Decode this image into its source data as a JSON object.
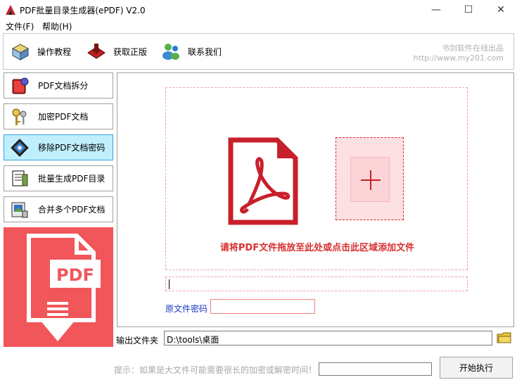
{
  "window": {
    "title": "PDF批量目录生成器(ePDF) V2.0",
    "minimize": "—",
    "maximize": "☐",
    "close": "✕"
  },
  "menu": {
    "file": "文件(F)",
    "help": "帮助(H)"
  },
  "toolbar": {
    "guide": "操作教程",
    "buy": "获取正版",
    "contact": "联系我们",
    "brand_line1": "书剑软件在线出品",
    "brand_line2": "http://www.my201.com"
  },
  "nav": {
    "items": [
      {
        "label": "PDF文档拆分",
        "icon": "book-split-icon",
        "active": false
      },
      {
        "label": "加密PDF文档",
        "icon": "key-icon",
        "active": false
      },
      {
        "label": "移除PDF文档密码",
        "icon": "unlock-icon",
        "active": true
      },
      {
        "label": "批量生成PDF目录",
        "icon": "catalog-icon",
        "active": false
      },
      {
        "label": "合并多个PDF文档",
        "icon": "merge-icon",
        "active": false
      }
    ]
  },
  "promo": {
    "badge": "PDF",
    "color": "#f1565b"
  },
  "main": {
    "drop_text": "请将PDF文件拖放至此处或点击此区域添加文件",
    "file_path_value": "",
    "password_label": "原文件密码",
    "password_value": ""
  },
  "output": {
    "label": "输出文件夹",
    "value": "D:\\tools\\桌面"
  },
  "footer": {
    "hint": "提示：如果是大文件可能需要很长的加密或解密时间！",
    "progress": 0,
    "start_label": "开始执行"
  },
  "colors": {
    "accent_red": "#d83030",
    "active_nav": "#bfeffc",
    "label_blue": "#1a3ac0"
  }
}
